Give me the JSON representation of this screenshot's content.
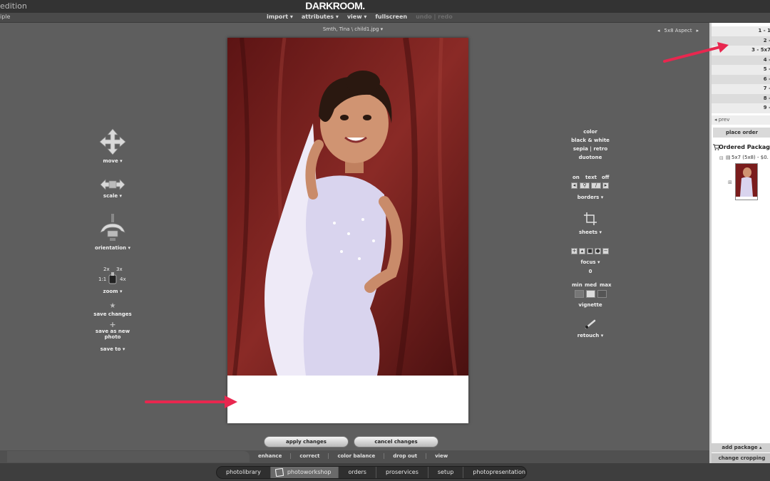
{
  "app": {
    "edition_text": "edition",
    "logo": "DARKROOM."
  },
  "menubar": {
    "left_text": "iple",
    "items": [
      "import ▾",
      "attributes ▾",
      "view ▾",
      "fullscreen"
    ],
    "disabled": "undo | redo"
  },
  "photo": {
    "filename": "Smth, Tina \\ child1.jpg ▾",
    "aspect": "5x8 Aspect",
    "aspect_prev": "◂",
    "aspect_next": "▸"
  },
  "left_tools": {
    "move": "move ▾",
    "scale": "scale ▾",
    "orientation": "orientation ▾",
    "zoom_2x": "2x",
    "zoom_3x": "3x",
    "zoom_1_1": "1:1",
    "zoom_4x": "4x",
    "zoom": "zoom ▾",
    "save_changes": "save changes",
    "save_as_new_photo": "save as new photo",
    "save_to": "save to ▾"
  },
  "right_tools": {
    "color": "color",
    "black_white": "black & white",
    "sepia": "sepia",
    "retro": "retro",
    "duotone": "duotone",
    "on": "on",
    "text": "text",
    "off": "off",
    "borders": "borders ▾",
    "sheets": "sheets ▾",
    "focus": "focus ▾",
    "focus_value": "0",
    "min": "min",
    "med": "med",
    "max": "max",
    "vignette": "vignette",
    "retouch": "retouch ▾"
  },
  "sidebar": {
    "rows": [
      "1 - 1",
      "2 -",
      "3 - 5x7",
      "4 -",
      "5 -",
      "6 - ",
      "7 - ",
      "8 - ",
      "9 - "
    ],
    "prev": "◂ prev",
    "place_order": "place order",
    "ordered_packages": "Ordered Packag",
    "package_line": "5x7 (5x8) - $0.",
    "add_package": "add package ▴",
    "change_cropping": "change cropping"
  },
  "actions": {
    "apply": "apply changes",
    "cancel": "cancel changes"
  },
  "edit_tabs": [
    "enhance",
    "correct",
    "color balance",
    "drop out",
    "view"
  ],
  "nav": {
    "items": [
      "photolibrary",
      "photoworkshop",
      "orders",
      "proservices",
      "setup",
      "photopresentation"
    ],
    "active": "photoworkshop"
  },
  "colors": {
    "arrow": "#e8274f",
    "backdrop": "#7a1c1c",
    "dress": "#d9d4ee"
  }
}
